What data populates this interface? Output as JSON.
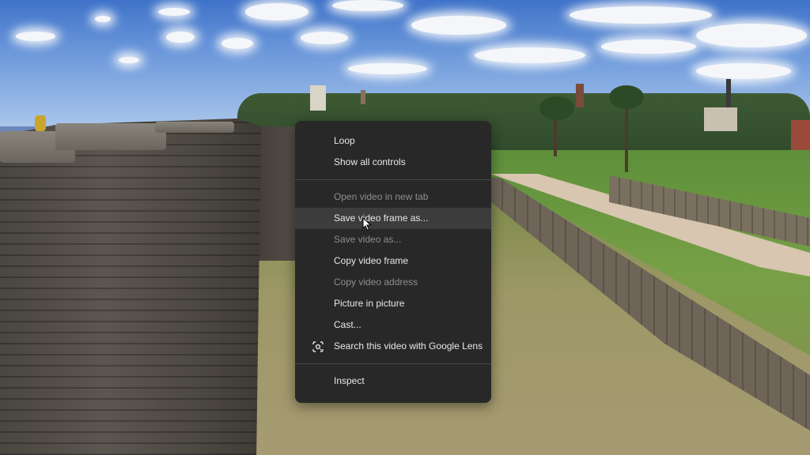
{
  "video": {
    "scene_icon": "castle-moat-video-frame"
  },
  "context_menu": {
    "items": [
      {
        "label": "Loop",
        "enabled": true
      },
      {
        "label": "Show all controls",
        "enabled": true
      },
      {
        "label": "Open video in new tab",
        "enabled": false
      },
      {
        "label": "Save video frame as...",
        "enabled": true,
        "hovered": true
      },
      {
        "label": "Save video as...",
        "enabled": false
      },
      {
        "label": "Copy video frame",
        "enabled": true
      },
      {
        "label": "Copy video address",
        "enabled": false
      },
      {
        "label": "Picture in picture",
        "enabled": true
      },
      {
        "label": "Cast...",
        "enabled": true
      },
      {
        "label": "Search this video with Google Lens",
        "enabled": true,
        "icon": "google-lens-icon"
      },
      {
        "label": "Inspect",
        "enabled": true
      }
    ]
  },
  "colors": {
    "menu_background": "#282828",
    "menu_hover": "#3c3c3c",
    "text_enabled": "#e8e8e8",
    "text_disabled": "#8e8e8e"
  }
}
